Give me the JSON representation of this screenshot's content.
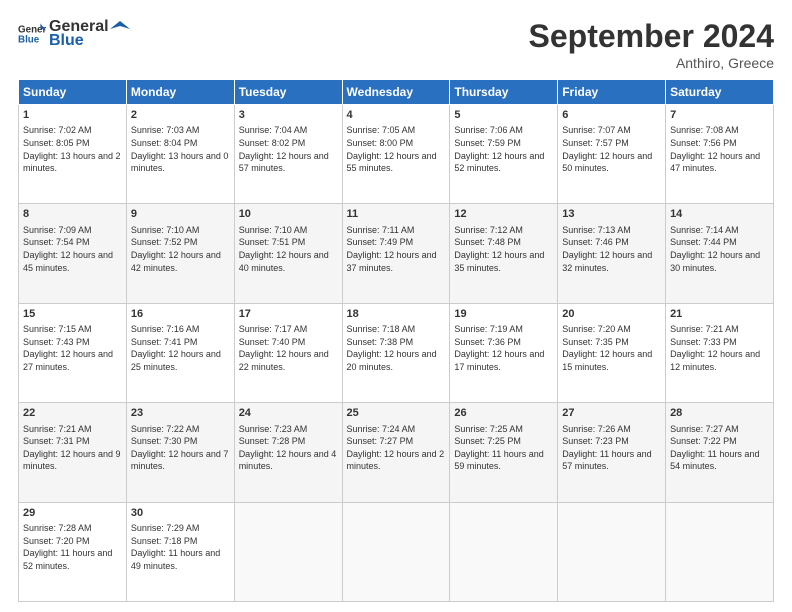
{
  "header": {
    "logo_general": "General",
    "logo_blue": "Blue",
    "month_title": "September 2024",
    "location": "Anthiro, Greece"
  },
  "days_of_week": [
    "Sunday",
    "Monday",
    "Tuesday",
    "Wednesday",
    "Thursday",
    "Friday",
    "Saturday"
  ],
  "weeks": [
    [
      {
        "day": "1",
        "sunrise": "7:02 AM",
        "sunset": "8:05 PM",
        "daylight": "13 hours and 2 minutes."
      },
      {
        "day": "2",
        "sunrise": "7:03 AM",
        "sunset": "8:04 PM",
        "daylight": "13 hours and 0 minutes."
      },
      {
        "day": "3",
        "sunrise": "7:04 AM",
        "sunset": "8:02 PM",
        "daylight": "12 hours and 57 minutes."
      },
      {
        "day": "4",
        "sunrise": "7:05 AM",
        "sunset": "8:00 PM",
        "daylight": "12 hours and 55 minutes."
      },
      {
        "day": "5",
        "sunrise": "7:06 AM",
        "sunset": "7:59 PM",
        "daylight": "12 hours and 52 minutes."
      },
      {
        "day": "6",
        "sunrise": "7:07 AM",
        "sunset": "7:57 PM",
        "daylight": "12 hours and 50 minutes."
      },
      {
        "day": "7",
        "sunrise": "7:08 AM",
        "sunset": "7:56 PM",
        "daylight": "12 hours and 47 minutes."
      }
    ],
    [
      {
        "day": "8",
        "sunrise": "7:09 AM",
        "sunset": "7:54 PM",
        "daylight": "12 hours and 45 minutes."
      },
      {
        "day": "9",
        "sunrise": "7:10 AM",
        "sunset": "7:52 PM",
        "daylight": "12 hours and 42 minutes."
      },
      {
        "day": "10",
        "sunrise": "7:10 AM",
        "sunset": "7:51 PM",
        "daylight": "12 hours and 40 minutes."
      },
      {
        "day": "11",
        "sunrise": "7:11 AM",
        "sunset": "7:49 PM",
        "daylight": "12 hours and 37 minutes."
      },
      {
        "day": "12",
        "sunrise": "7:12 AM",
        "sunset": "7:48 PM",
        "daylight": "12 hours and 35 minutes."
      },
      {
        "day": "13",
        "sunrise": "7:13 AM",
        "sunset": "7:46 PM",
        "daylight": "12 hours and 32 minutes."
      },
      {
        "day": "14",
        "sunrise": "7:14 AM",
        "sunset": "7:44 PM",
        "daylight": "12 hours and 30 minutes."
      }
    ],
    [
      {
        "day": "15",
        "sunrise": "7:15 AM",
        "sunset": "7:43 PM",
        "daylight": "12 hours and 27 minutes."
      },
      {
        "day": "16",
        "sunrise": "7:16 AM",
        "sunset": "7:41 PM",
        "daylight": "12 hours and 25 minutes."
      },
      {
        "day": "17",
        "sunrise": "7:17 AM",
        "sunset": "7:40 PM",
        "daylight": "12 hours and 22 minutes."
      },
      {
        "day": "18",
        "sunrise": "7:18 AM",
        "sunset": "7:38 PM",
        "daylight": "12 hours and 20 minutes."
      },
      {
        "day": "19",
        "sunrise": "7:19 AM",
        "sunset": "7:36 PM",
        "daylight": "12 hours and 17 minutes."
      },
      {
        "day": "20",
        "sunrise": "7:20 AM",
        "sunset": "7:35 PM",
        "daylight": "12 hours and 15 minutes."
      },
      {
        "day": "21",
        "sunrise": "7:21 AM",
        "sunset": "7:33 PM",
        "daylight": "12 hours and 12 minutes."
      }
    ],
    [
      {
        "day": "22",
        "sunrise": "7:21 AM",
        "sunset": "7:31 PM",
        "daylight": "12 hours and 9 minutes."
      },
      {
        "day": "23",
        "sunrise": "7:22 AM",
        "sunset": "7:30 PM",
        "daylight": "12 hours and 7 minutes."
      },
      {
        "day": "24",
        "sunrise": "7:23 AM",
        "sunset": "7:28 PM",
        "daylight": "12 hours and 4 minutes."
      },
      {
        "day": "25",
        "sunrise": "7:24 AM",
        "sunset": "7:27 PM",
        "daylight": "12 hours and 2 minutes."
      },
      {
        "day": "26",
        "sunrise": "7:25 AM",
        "sunset": "7:25 PM",
        "daylight": "11 hours and 59 minutes."
      },
      {
        "day": "27",
        "sunrise": "7:26 AM",
        "sunset": "7:23 PM",
        "daylight": "11 hours and 57 minutes."
      },
      {
        "day": "28",
        "sunrise": "7:27 AM",
        "sunset": "7:22 PM",
        "daylight": "11 hours and 54 minutes."
      }
    ],
    [
      {
        "day": "29",
        "sunrise": "7:28 AM",
        "sunset": "7:20 PM",
        "daylight": "11 hours and 52 minutes."
      },
      {
        "day": "30",
        "sunrise": "7:29 AM",
        "sunset": "7:18 PM",
        "daylight": "11 hours and 49 minutes."
      },
      null,
      null,
      null,
      null,
      null
    ]
  ]
}
